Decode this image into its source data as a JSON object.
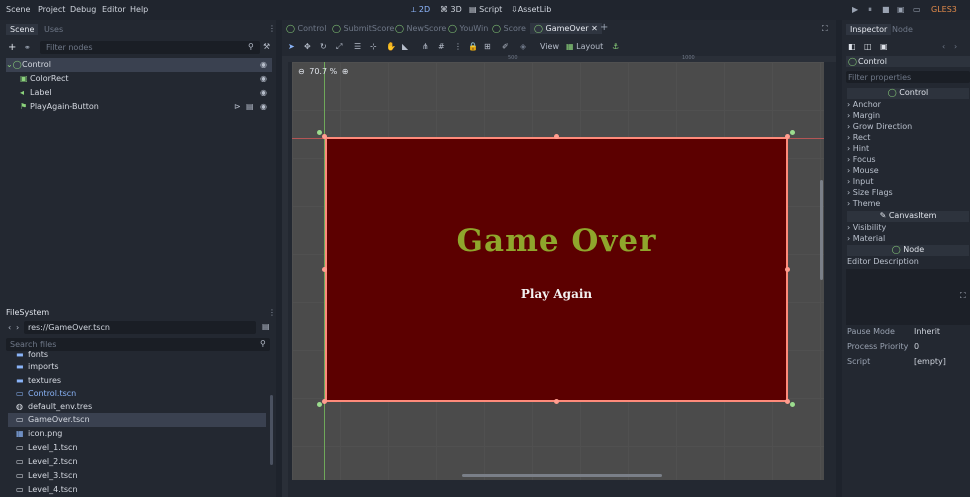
{
  "menu": {
    "items": [
      "Scene",
      "Project",
      "Debug",
      "Editor",
      "Help"
    ],
    "workspaces": [
      "2D",
      "3D",
      "Script",
      "AssetLib"
    ],
    "renderer": "GLES3"
  },
  "scene_dock": {
    "tabs": [
      "Scene",
      "Uses"
    ],
    "filter_placeholder": "Filter nodes",
    "nodes": [
      {
        "label": "Control",
        "selected": true
      },
      {
        "label": "ColorRect",
        "selected": false
      },
      {
        "label": "Label",
        "selected": false
      },
      {
        "label": "PlayAgain-Button",
        "selected": false
      }
    ]
  },
  "filesystem": {
    "title": "FileSystem",
    "path": "res://GameOver.tscn",
    "search_placeholder": "Search files",
    "items": [
      {
        "label": "fonts",
        "selected": false
      },
      {
        "label": "imports",
        "selected": false
      },
      {
        "label": "textures",
        "selected": false
      },
      {
        "label": "Control.tscn",
        "selected": false
      },
      {
        "label": "default_env.tres",
        "selected": false
      },
      {
        "label": "GameOver.tscn",
        "selected": true
      },
      {
        "label": "icon.png",
        "selected": false
      },
      {
        "label": "Level_1.tscn",
        "selected": false
      },
      {
        "label": "Level_2.tscn",
        "selected": false
      },
      {
        "label": "Level_3.tscn",
        "selected": false
      },
      {
        "label": "Level_4.tscn",
        "selected": false
      }
    ]
  },
  "editor": {
    "scene_tabs": [
      "Control",
      "SubmitScore",
      "NewScore",
      "YouWin",
      "Score",
      "GameOver"
    ],
    "active_tab": "GameOver",
    "toolbar": {
      "view_label": "View",
      "layout_label": "Layout"
    },
    "zoom": "70.7 %",
    "ruler_marks": [
      "500",
      "1000"
    ],
    "game_over_title": "Game Over",
    "play_again_label": "Play Again"
  },
  "inspector": {
    "tabs": [
      "Inspector",
      "Node"
    ],
    "object_name": "Control",
    "filter_placeholder": "Filter properties",
    "section_control": "Control",
    "control_props": [
      "Anchor",
      "Margin",
      "Grow Direction",
      "Rect",
      "Hint",
      "Focus",
      "Mouse",
      "Input",
      "Size Flags",
      "Theme"
    ],
    "section_canvasitem": "CanvasItem",
    "canvasitem_props": [
      "Visibility",
      "Material"
    ],
    "section_node": "Node",
    "editor_description": "Editor Description",
    "pause_mode_label": "Pause Mode",
    "pause_mode_value": "Inherit",
    "process_priority_label": "Process Priority",
    "process_priority_value": "0",
    "script_label": "Script",
    "script_value": "[empty]"
  },
  "colors": {
    "background": "#5c0000",
    "title_color": "#8fa62c",
    "selection_outline": "#ff8a7a"
  }
}
